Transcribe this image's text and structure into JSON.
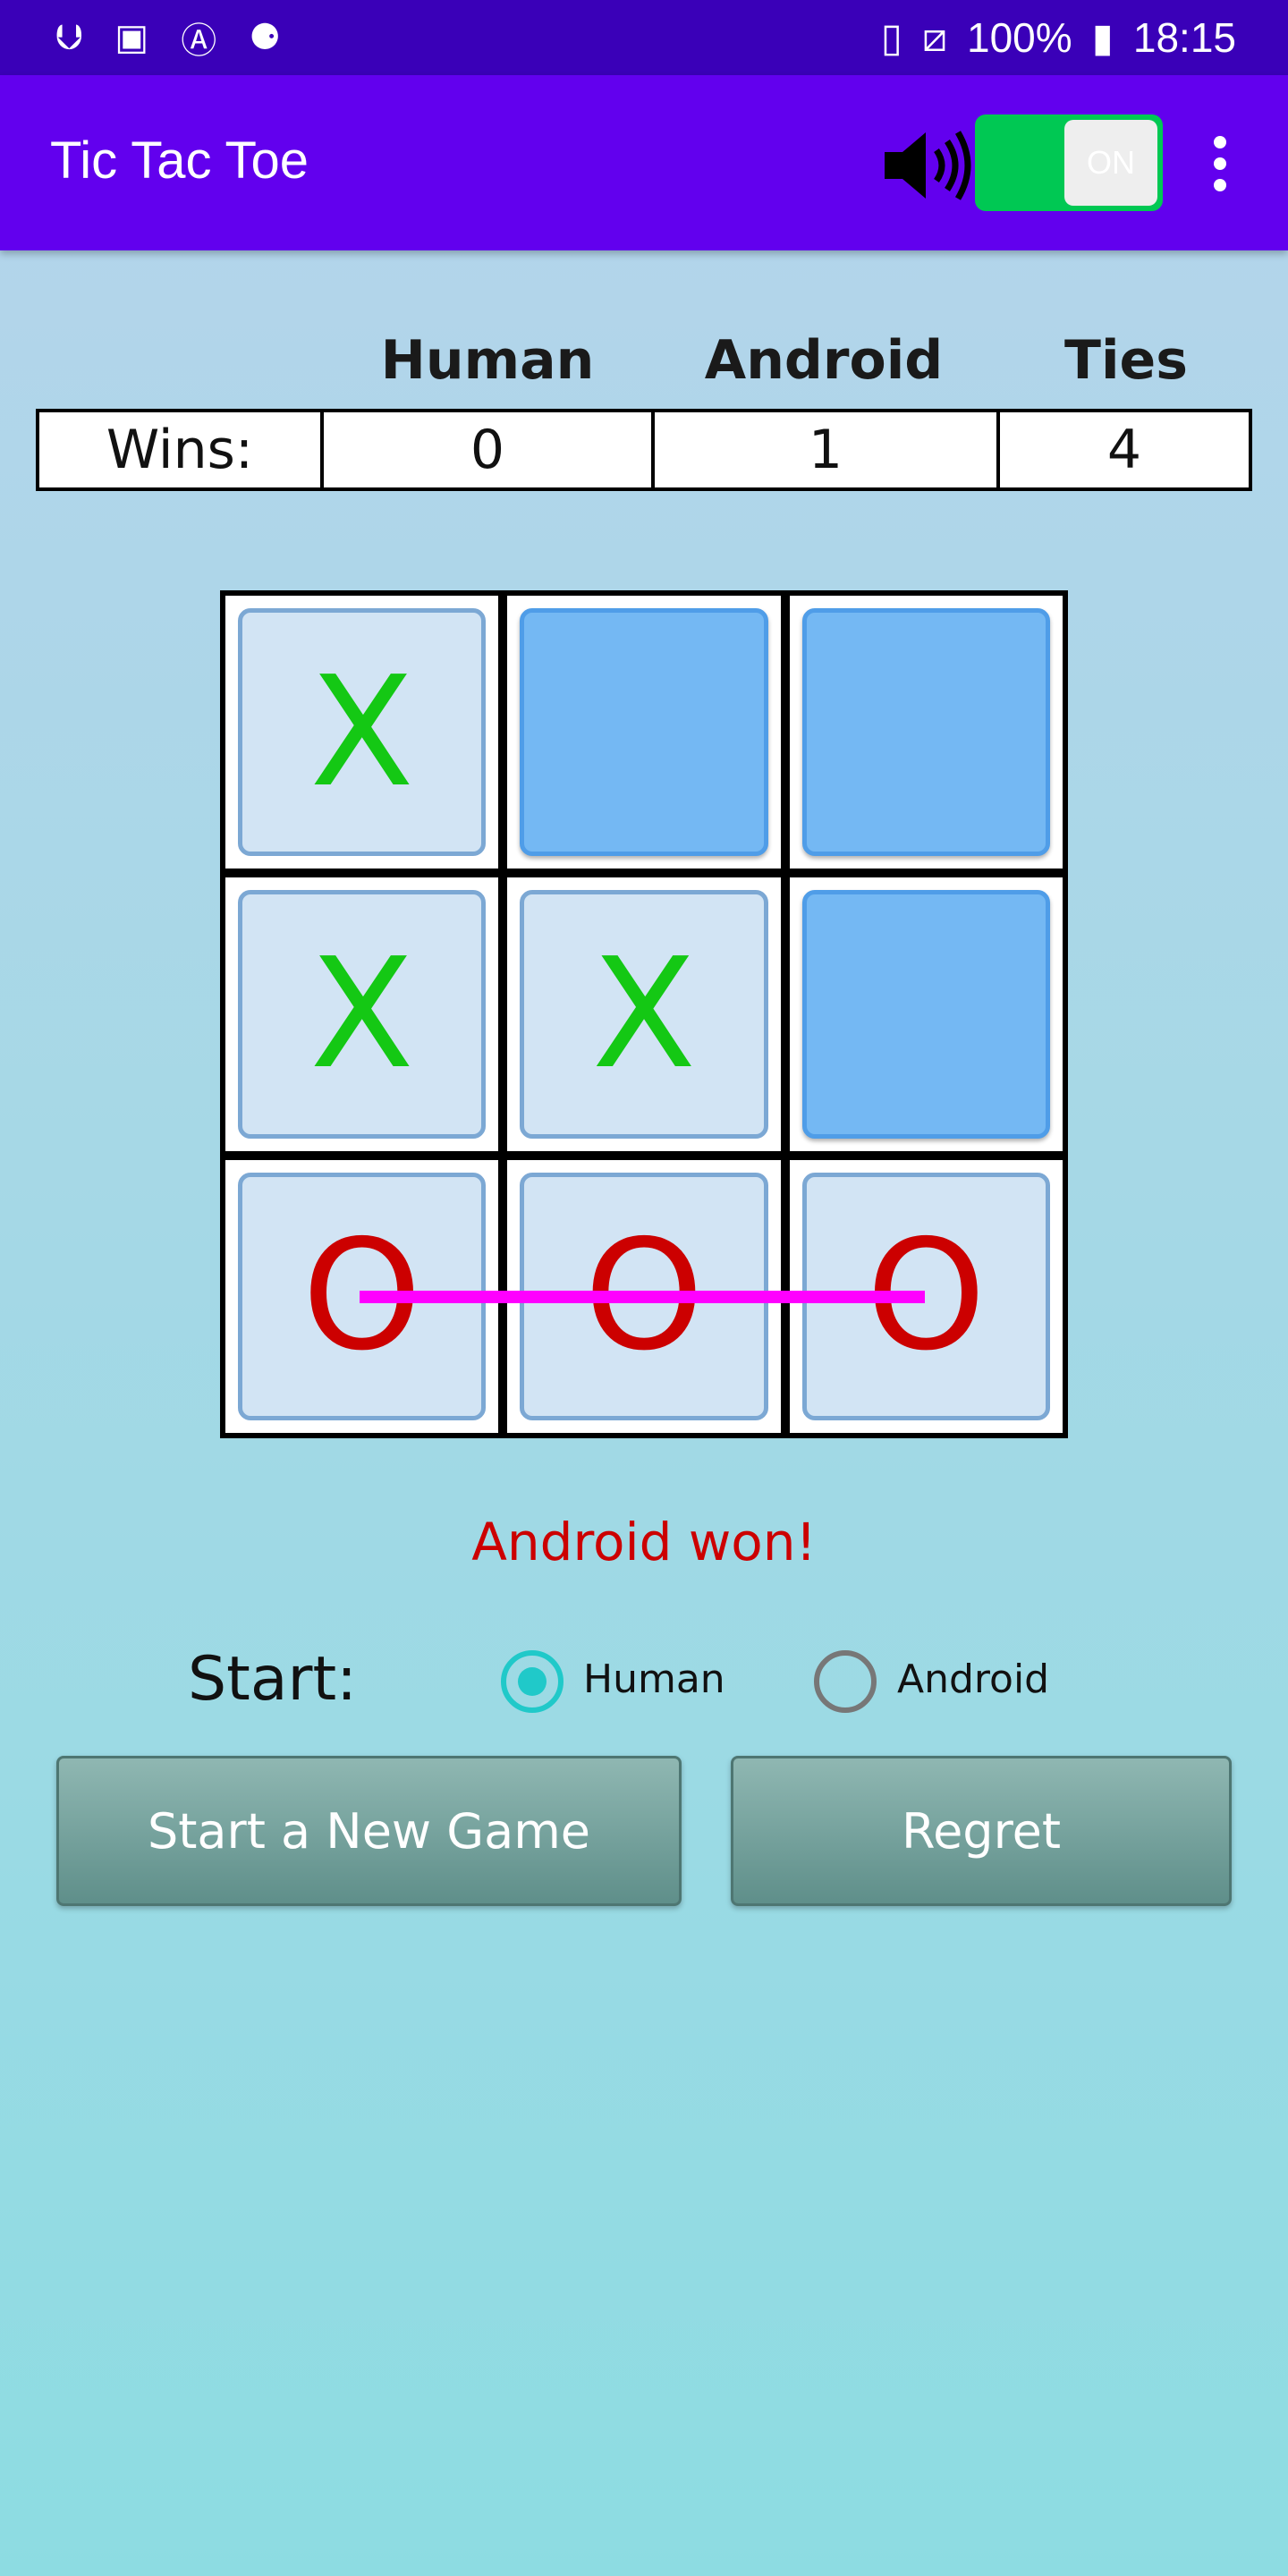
{
  "status_bar": {
    "icons": [
      "usb-icon",
      "image-icon",
      "accessibility-icon",
      "debug-icon"
    ],
    "right_icons": [
      "vibrate-icon",
      "no-sim-icon"
    ],
    "battery": "100%",
    "time": "18:15"
  },
  "app_bar": {
    "title": "Tic Tac Toe",
    "sound_toggle_label": "ON",
    "sound_on": true
  },
  "scores": {
    "headers": [
      "Human",
      "Android",
      "Ties"
    ],
    "row_label": "Wins:",
    "values": [
      "0",
      "1",
      "4"
    ]
  },
  "board": {
    "cells": [
      "X",
      "",
      "",
      "X",
      "X",
      "",
      "O",
      "O",
      "O"
    ],
    "winning_line": "bottom-row"
  },
  "result": "Android won!",
  "start": {
    "label": "Start:",
    "options": [
      "Human",
      "Android"
    ],
    "selected": "Human"
  },
  "buttons": {
    "new_game": "Start a New Game",
    "regret": "Regret"
  },
  "colors": {
    "status_bar": "#3a00b8",
    "app_bar": "#6200ee",
    "x_mark": "#14c814",
    "o_mark": "#cc0000",
    "win_line": "#ff00ff"
  }
}
